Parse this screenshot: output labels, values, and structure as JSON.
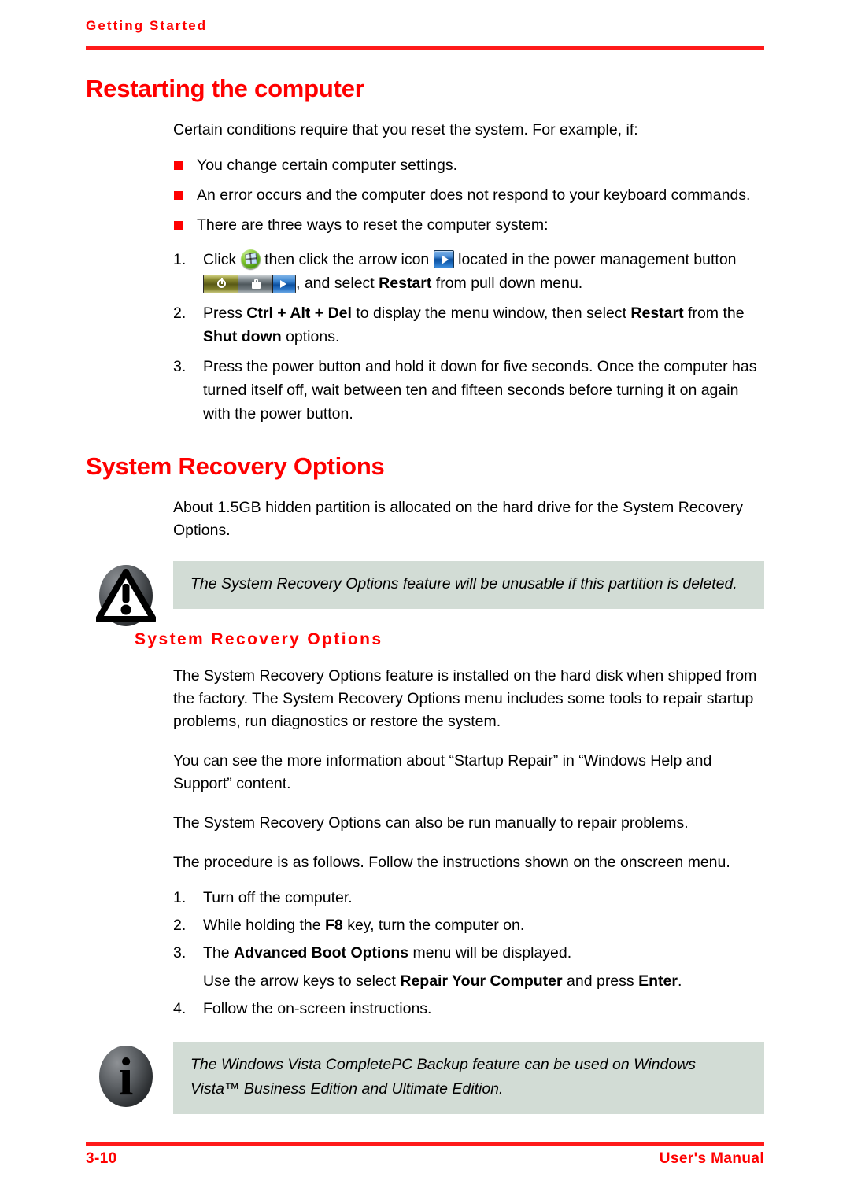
{
  "header": {
    "running_title": "Getting Started"
  },
  "footer": {
    "page_number": "3-10",
    "manual_label": "User's Manual"
  },
  "sections": {
    "restarting": {
      "title": "Restarting the computer",
      "intro": "Certain conditions require that you reset the system. For example, if:",
      "bullets": [
        "You change certain computer settings.",
        "An error occurs and the computer does not respond to your keyboard commands.",
        "There are three ways to reset the computer system:"
      ],
      "steps": [
        {
          "num": "1.",
          "part1": "Click",
          "part2": "then click the arrow icon",
          "part3": "located in the power management button",
          "part4": ", and select",
          "bold1": "Restart",
          "part5": "from pull down menu."
        },
        {
          "num": "2.",
          "part1": "Press",
          "bold1": "Ctrl + Alt + Del",
          "part2": "to display the menu window, then select",
          "bold2": "Restart",
          "part3": "from the",
          "bold3": "Shut down",
          "part4": "options."
        },
        {
          "num": "3.",
          "text": "Press the power button and hold it down for five seconds. Once the computer has turned itself off, wait between ten and fifteen seconds before turning it on again with the power button."
        }
      ]
    },
    "system_recovery": {
      "title": "System Recovery Options",
      "intro": "About 1.5GB hidden partition is allocated on the hard drive for the System Recovery Options.",
      "warning_callout": "The System Recovery Options feature will be unusable if this partition is deleted.",
      "subtitle": "System Recovery Options",
      "paragraphs": [
        "The System Recovery Options feature is installed on the hard disk when shipped from the factory. The System Recovery Options menu includes some tools to repair startup problems, run diagnostics or restore the system.",
        "You can see the more information about “Startup Repair” in “Windows Help and Support” content.",
        "The System Recovery Options can also be run manually to repair problems.",
        "The procedure is as follows. Follow the instructions shown on the onscreen menu."
      ],
      "steps": [
        {
          "num": "1.",
          "text": "Turn off the computer."
        },
        {
          "num": "2.",
          "part1": "While holding the",
          "bold1": "F8",
          "part2": "key, turn the computer on."
        },
        {
          "num": "3.",
          "part1": "The",
          "bold1": "Advanced Boot Options",
          "part2": "menu will be displayed.",
          "sub_part1": "Use the arrow keys to select",
          "sub_bold1": "Repair Your Computer",
          "sub_part2": "and press",
          "sub_bold2": "Enter",
          "sub_part3": "."
        },
        {
          "num": "4.",
          "text": "Follow the on-screen instructions."
        }
      ],
      "info_callout": "The Windows Vista CompletePC Backup feature can be used on Windows Vista™ Business Edition and Ultimate Edition."
    }
  },
  "icons": {
    "vista_orb": "windows-vista-start-orb-icon",
    "arrow_button": "blue-arrow-button-icon",
    "power_bar": "power-management-button-icon",
    "warning": "warning-triangle-icon",
    "info": "information-icon"
  },
  "colors": {
    "accent_red": "#ff0000",
    "callout_background": "#d2dcd5",
    "text": "#000000"
  }
}
